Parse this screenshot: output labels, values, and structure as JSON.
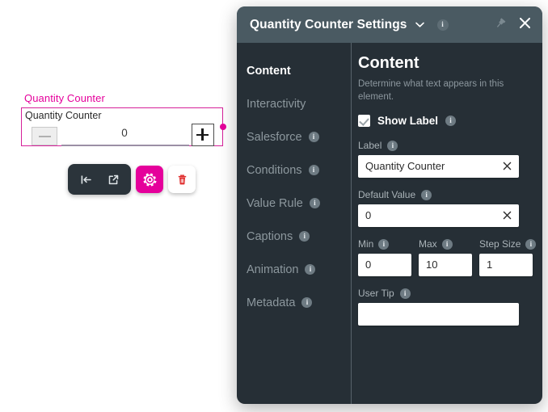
{
  "canvas": {
    "widget_caption": "Quantity Counter",
    "widget_inner_label": "Quantity Counter",
    "counter_value": "0",
    "minus_icon": "minus-icon",
    "plus_icon": "plus-icon",
    "accent_color": "#e5009b"
  },
  "element_toolbar": {
    "items": [
      {
        "icon": "align-left-icon",
        "label": ""
      },
      {
        "icon": "open-external-icon",
        "label": ""
      },
      {
        "icon": "gear-icon",
        "label": ""
      },
      {
        "icon": "trash-icon",
        "label": ""
      }
    ]
  },
  "panel": {
    "header": {
      "title": "Quantity Counter Settings",
      "chevron_icon": "chevron-down-icon",
      "info_icon": "info-icon",
      "pin_icon": "pin-icon",
      "close_icon": "close-icon"
    },
    "sidebar": {
      "items": [
        {
          "label": "Content",
          "active": true,
          "info": false
        },
        {
          "label": "Interactivity",
          "active": false,
          "info": false
        },
        {
          "label": "Salesforce",
          "active": false,
          "info": true
        },
        {
          "label": "Conditions",
          "active": false,
          "info": true
        },
        {
          "label": "Value Rule",
          "active": false,
          "info": true
        },
        {
          "label": "Captions",
          "active": false,
          "info": true
        },
        {
          "label": "Animation",
          "active": false,
          "info": true
        },
        {
          "label": "Metadata",
          "active": false,
          "info": true
        }
      ]
    },
    "content": {
      "title": "Content",
      "description": "Determine what text appears in this element.",
      "show_label": {
        "label": "Show Label",
        "checked": true
      },
      "label_field": {
        "label": "Label",
        "value": "Quantity Counter",
        "placeholder": ""
      },
      "default_value_field": {
        "label": "Default Value",
        "value": "0",
        "placeholder": ""
      },
      "min_field": {
        "label": "Min",
        "value": "0"
      },
      "max_field": {
        "label": "Max",
        "value": "10"
      },
      "step_size_field": {
        "label": "Step Size",
        "value": "1"
      },
      "user_tip_field": {
        "label": "User Tip",
        "value": "",
        "placeholder": ""
      },
      "clear_icon": "clear-x-icon"
    }
  },
  "colors": {
    "panel_bg": "#262f36",
    "header_bg": "#4a5a62",
    "accent": "#e5009b",
    "muted_text": "#8d989e"
  }
}
